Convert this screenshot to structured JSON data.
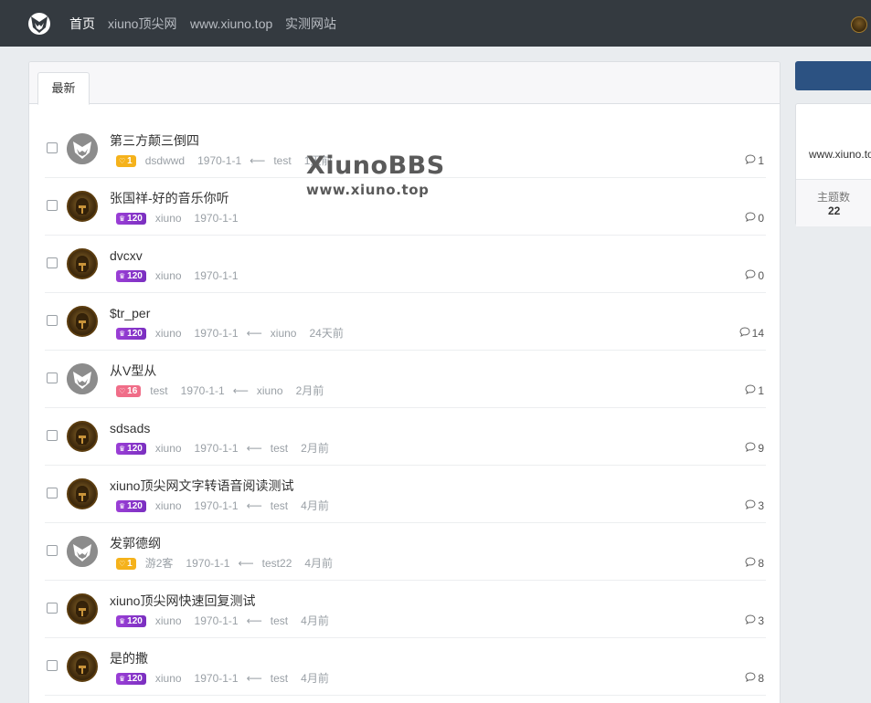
{
  "nav": {
    "links": [
      "首页",
      "xiuno顶尖网",
      "www.xiuno.top",
      "实测网站"
    ]
  },
  "tabs": {
    "latest": "最新"
  },
  "watermark": {
    "line1": "XiunoBBS",
    "line2": "www.xiuno.top"
  },
  "threads": [
    {
      "title": "第三方颠三倒四",
      "avatar": "gray",
      "badge": {
        "type": "heart-gold",
        "icon": "heart-icon",
        "value": "1"
      },
      "author": "dsdwwd",
      "date": "1970-1-1",
      "last_user": "test",
      "last_time": "1天前",
      "replies": "1"
    },
    {
      "title": "张国祥-好的音乐你听",
      "avatar": "gold",
      "badge": {
        "type": "crown",
        "icon": "crown-icon",
        "value": "120"
      },
      "author": "xiuno",
      "date": "1970-1-1",
      "last_user": "",
      "last_time": "",
      "replies": "0"
    },
    {
      "title": "dvcxv",
      "avatar": "gold",
      "badge": {
        "type": "crown",
        "icon": "crown-icon",
        "value": "120"
      },
      "author": "xiuno",
      "date": "1970-1-1",
      "last_user": "",
      "last_time": "",
      "replies": "0"
    },
    {
      "title": "$tr_per",
      "avatar": "gold",
      "badge": {
        "type": "crown",
        "icon": "crown-icon",
        "value": "120"
      },
      "author": "xiuno",
      "date": "1970-1-1",
      "last_user": "xiuno",
      "last_time": "24天前",
      "replies": "14"
    },
    {
      "title": "从V型从",
      "avatar": "gray",
      "badge": {
        "type": "heart-red",
        "icon": "heart-icon",
        "value": "16"
      },
      "author": "test",
      "date": "1970-1-1",
      "last_user": "xiuno",
      "last_time": "2月前",
      "replies": "1"
    },
    {
      "title": "sdsads",
      "avatar": "gold",
      "badge": {
        "type": "crown",
        "icon": "crown-icon",
        "value": "120"
      },
      "author": "xiuno",
      "date": "1970-1-1",
      "last_user": "test",
      "last_time": "2月前",
      "replies": "9"
    },
    {
      "title": "xiuno顶尖网文字转语音阅读测试",
      "avatar": "gold",
      "badge": {
        "type": "crown",
        "icon": "crown-icon",
        "value": "120"
      },
      "author": "xiuno",
      "date": "1970-1-1",
      "last_user": "test",
      "last_time": "4月前",
      "replies": "3"
    },
    {
      "title": "发郭德纲",
      "avatar": "gray",
      "badge": {
        "type": "heart-gold",
        "icon": "heart-icon",
        "value": "1"
      },
      "author": "游2客",
      "date": "1970-1-1",
      "last_user": "test22",
      "last_time": "4月前",
      "replies": "8"
    },
    {
      "title": "xiuno顶尖网快速回复测试",
      "avatar": "gold",
      "badge": {
        "type": "crown",
        "icon": "crown-icon",
        "value": "120"
      },
      "author": "xiuno",
      "date": "1970-1-1",
      "last_user": "test",
      "last_time": "4月前",
      "replies": "3"
    },
    {
      "title": "是的撒",
      "avatar": "gold",
      "badge": {
        "type": "crown",
        "icon": "crown-icon",
        "value": "120"
      },
      "author": "xiuno",
      "date": "1970-1-1",
      "last_user": "test",
      "last_time": "4月前",
      "replies": "8"
    }
  ],
  "sidebar": {
    "site": "www.xiuno.to",
    "stat_label": "主题数",
    "stat_value": "22"
  }
}
